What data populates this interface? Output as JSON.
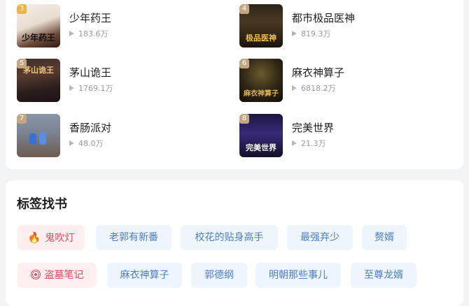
{
  "ranking": {
    "books": [
      {
        "rank": "3",
        "title": "少年药王",
        "reads": "183.6万",
        "cover_text": "少年药王"
      },
      {
        "rank": "4",
        "title": "都市极品医神",
        "reads": "819.3万",
        "cover_text": "极品医神"
      },
      {
        "rank": "5",
        "title": "茅山诡王",
        "reads": "1769.1万",
        "cover_text": "茅山诡王"
      },
      {
        "rank": "6",
        "title": "麻衣神算子",
        "reads": "6818.2万",
        "cover_text": "麻衣神算子"
      },
      {
        "rank": "7",
        "title": "香肠派对",
        "reads": "48.0万",
        "cover_text": ""
      },
      {
        "rank": "8",
        "title": "完美世界",
        "reads": "21.3万",
        "cover_text": "完美世界"
      }
    ]
  },
  "tags": {
    "title": "标签找书",
    "row1": [
      {
        "label": "鬼吹灯",
        "icon": "fire-icon",
        "hot": true
      },
      {
        "label": "老郭有新番"
      },
      {
        "label": "校花的贴身高手"
      },
      {
        "label": "最强弃少"
      },
      {
        "label": "赘婿"
      }
    ],
    "row2": [
      {
        "label": "盗墓笔记",
        "icon": "target-icon",
        "hot": true
      },
      {
        "label": "麻衣神算子"
      },
      {
        "label": "郭德纲"
      },
      {
        "label": "明朝那些事儿"
      },
      {
        "label": "至尊龙婿"
      }
    ]
  },
  "colors": {
    "tag_bg": "#eef5fd",
    "tag_text": "#4a7fc8",
    "hot_bg": "#fdeef0",
    "hot_text": "#e5475d"
  }
}
